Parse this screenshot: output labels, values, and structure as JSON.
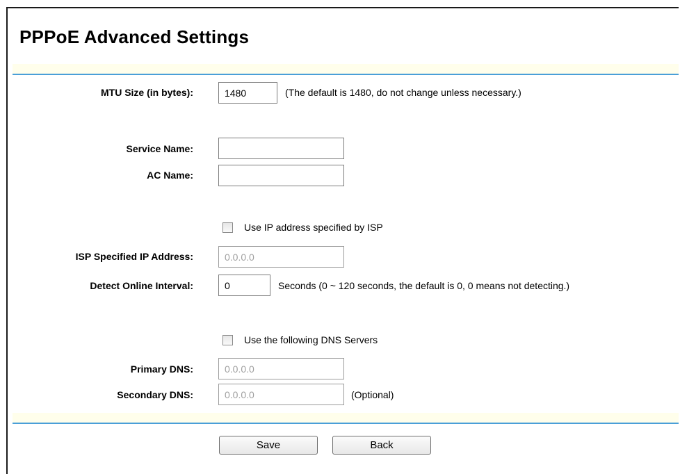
{
  "page": {
    "title": "PPPoE Advanced Settings"
  },
  "mtu": {
    "label": "MTU Size (in bytes):",
    "value": "1480",
    "note": "(The default is 1480, do not change unless necessary.)"
  },
  "service_name": {
    "label": "Service Name:",
    "value": ""
  },
  "ac_name": {
    "label": "AC Name:",
    "value": ""
  },
  "isp_ip": {
    "checkbox_label": "Use IP address specified by ISP",
    "checked": false,
    "label": "ISP Specified IP Address:",
    "value": "0.0.0.0"
  },
  "detect_interval": {
    "label": "Detect Online Interval:",
    "value": "0",
    "note": "Seconds (0 ~ 120 seconds, the default is 0, 0 means not detecting.)"
  },
  "dns": {
    "checkbox_label": "Use the following DNS Servers",
    "checked": false,
    "primary_label": "Primary DNS:",
    "primary_value": "0.0.0.0",
    "secondary_label": "Secondary DNS:",
    "secondary_value": "0.0.0.0",
    "secondary_note": "(Optional)"
  },
  "buttons": {
    "save": "Save",
    "back": "Back"
  },
  "colors": {
    "band": "#fffeeb",
    "band_border": "#4a9fd8"
  }
}
